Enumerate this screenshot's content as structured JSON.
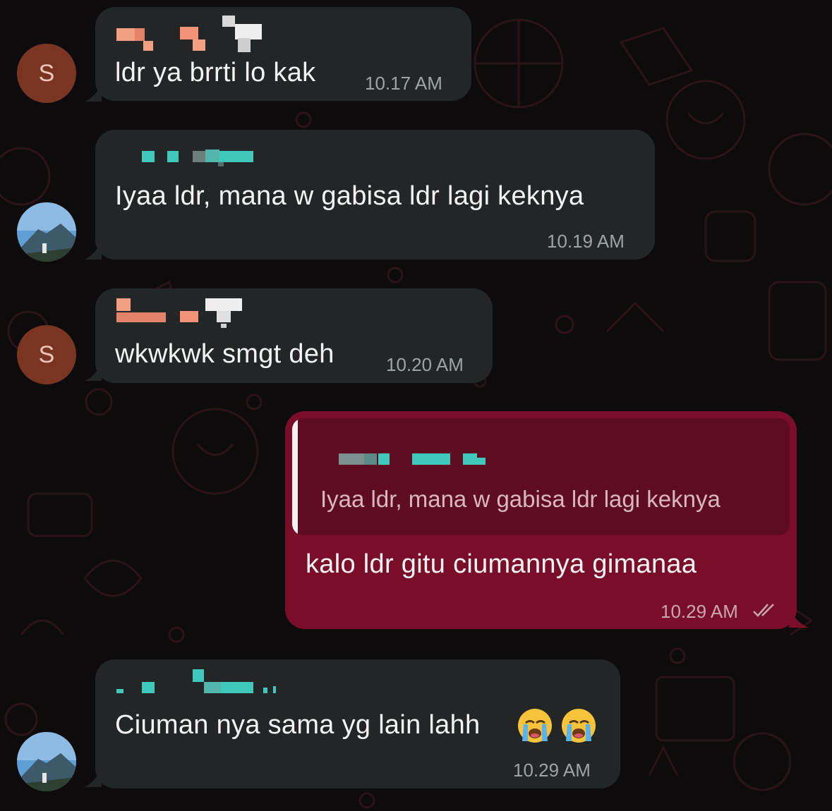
{
  "messages": [
    {
      "text": "ldr ya brrti lo kak",
      "time": "10.17 AM",
      "avatar_letter": "S"
    },
    {
      "text": "Iyaa ldr, mana w gabisa ldr lagi keknya",
      "time": "10.19 AM"
    },
    {
      "text": "wkwkwk smgt deh",
      "time": "10.20 AM",
      "avatar_letter": "S"
    },
    {
      "quote_text": "Iyaa ldr, mana w gabisa ldr lagi keknya",
      "text": "kalo ldr gitu ciumannya gimanaa",
      "time": "10.29 AM",
      "status_icon": "double-check-icon"
    },
    {
      "text": "Ciuman nya sama yg lain lahh",
      "emojis": [
        "loudly-crying-face",
        "loudly-crying-face"
      ],
      "time": "10.29 AM"
    }
  ],
  "colors": {
    "incoming_bubble": "#232626",
    "outgoing_bubble": "#7a0e2a",
    "quote_background": "#5e0c21",
    "background": "#0d0b0c",
    "avatar_s": "#7a3522",
    "name_salmon": "#f0a080",
    "name_teal": "#3fc9bd"
  }
}
